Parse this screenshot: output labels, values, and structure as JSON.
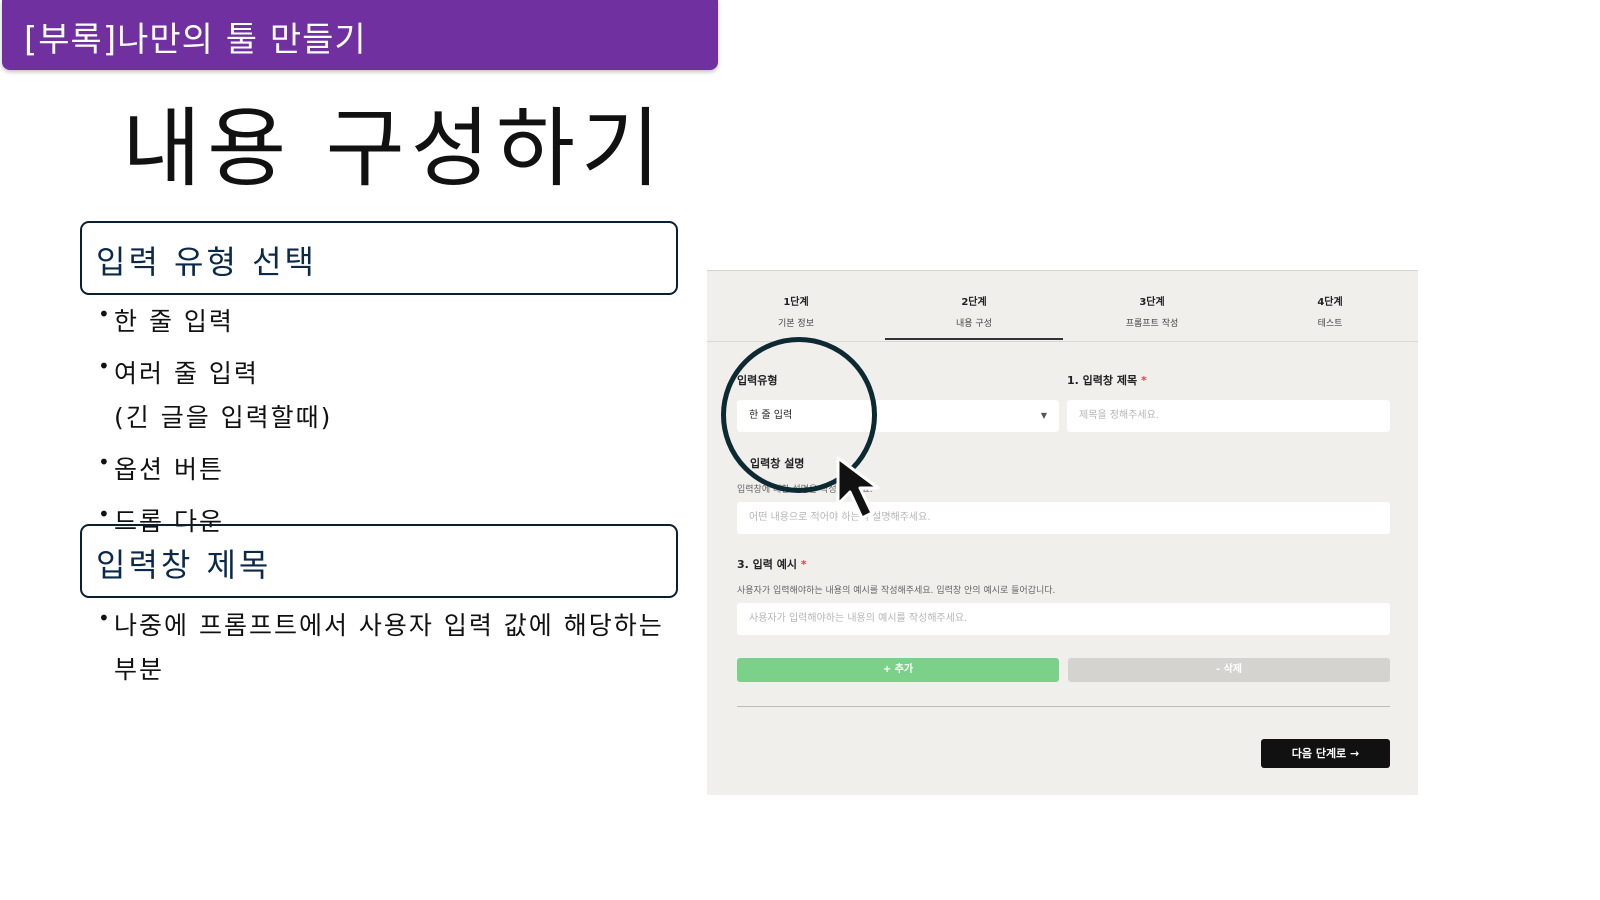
{
  "banner": {
    "text": "[부록]나만의 툴 만들기"
  },
  "slide_title": "내용 구성하기",
  "sections": [
    {
      "box_label": "입력 유형 선택",
      "bullets": [
        {
          "text": "한 줄 입력"
        },
        {
          "text": "여러 줄 입력",
          "sub": "(긴 글을 입력할때)"
        },
        {
          "text": "옵션 버튼"
        },
        {
          "text": "드롭 다운"
        }
      ]
    },
    {
      "box_label": "입력창 제목",
      "bullets": [
        {
          "text": "나중에 프롬프트에서 사용자 입력 값에 해당하는",
          "sub": "부분"
        }
      ]
    }
  ],
  "screenshot": {
    "steps": [
      {
        "num": "1단계",
        "label": "기본 정보"
      },
      {
        "num": "2단계",
        "label": "내용 구성"
      },
      {
        "num": "3단계",
        "label": "프롬프트 작성"
      },
      {
        "num": "4단계",
        "label": "테스트"
      }
    ],
    "active_step": 2,
    "input_type": {
      "label": "입력유형",
      "value": "한 줄 입력"
    },
    "input_title": {
      "label": "1. 입력창 제목",
      "required": "*",
      "placeholder": "제목을 정해주세요."
    },
    "input_desc": {
      "label": "입력창 설명",
      "help": "입력창에 대한 설명을 작성해주세요.",
      "placeholder": "어떤 내용으로 적어야 하는지 설명해주세요."
    },
    "input_example": {
      "label": "3. 입력 예시",
      "required": "*",
      "help": "사용자가 입력해야하는 내용의 예시를 작성해주세요. 입력창 안의 예시로 들어갑니다.",
      "placeholder": "사용자가 입력해야하는 내용의 예시를 작성해주세요."
    },
    "add_button": "+ 추가",
    "delete_button": "- 삭제",
    "next_button": "다음 단계로 →"
  },
  "icons": {
    "cursor": "mouse-pointer-icon",
    "dropdown": "chevron-down-icon"
  }
}
